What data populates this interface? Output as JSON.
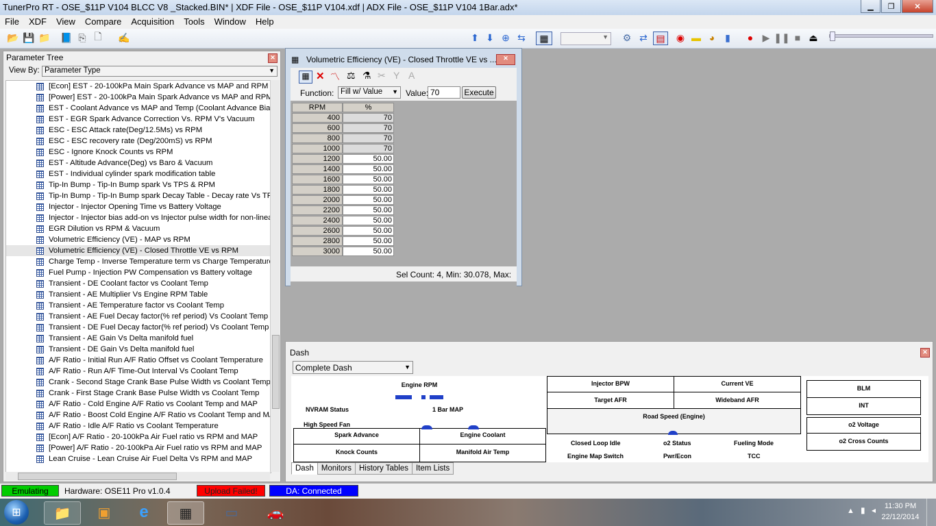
{
  "window": {
    "title": "TunerPro RT - OSE_$11P V104 BLCC V8 _Stacked.BIN* | XDF File - OSE_$11P V104.xdf | ADX File - OSE_$11P V104 1Bar.adx*"
  },
  "menu": [
    "File",
    "XDF",
    "View",
    "Compare",
    "Acquisition",
    "Tools",
    "Window",
    "Help"
  ],
  "param_tree": {
    "title": "Parameter Tree",
    "view_by_label": "View By:",
    "view_by_value": "Parameter Type",
    "items": [
      "[Econ] EST - 20-100kPa Main Spark Advance vs MAP and RPM",
      "[Power] EST - 20-100kPa Main Spark Advance vs MAP and RPM",
      "EST - Coolant Advance vs MAP and Temp (Coolant Advance Bias Te",
      "EST - EGR Spark Advance Correction Vs. RPM V's Vacuum",
      "ESC - ESC Attack rate(Deg/12.5Ms) vs RPM",
      "ESC - ESC recovery rate (Deg/200mS) vs RPM",
      "ESC - Ignore Knock Counts vs RPM",
      "EST - Altitude Advance(Deg) vs Baro & Vacuum",
      "EST - Individual cylinder spark modification table",
      "Tip-In Bump - Tip-In Bump spark Vs TPS & RPM",
      "Tip-In Bump - Tip-In Bump spark Decay Table - Decay rate Vs TPS",
      "Injector - Injector Opening Time vs Battery Voltage",
      "Injector - Injector bias add-on vs Injector pulse width for non-linea",
      "EGR Dilution vs RPM & Vacuum",
      "Volumetric Efficiency (VE) - MAP vs RPM",
      "Volumetric Efficiency (VE) - Closed Throttle VE vs RPM",
      "Charge Temp - Inverse Temperature term vs Charge Temperature",
      "Fuel Pump - Injection PW Compensation vs Battery voltage",
      "Transient - DE Coolant factor vs Coolant Temp",
      "Transient - AE Multiplier Vs Engine RPM Table",
      "Transient - AE Temperature factor vs Coolant Temp",
      "Transient - AE Fuel Decay factor(% ref period)  Vs Coolant Temp",
      "Transient - DE Fuel Decay factor(% ref period)  Vs Coolant Temp",
      "Transient - AE Gain Vs Delta manifold fuel",
      "Transient - DE Gain Vs Delta manifold fuel",
      "A/F Ratio - Initial Run A/F Ratio Offset vs Coolant Temperature",
      "A/F Ratio - Run A/F Time-Out Interval Vs Coolant Temp",
      "Crank - Second Stage Crank Base Pulse Width vs Coolant Temp",
      "Crank - First Stage Crank Base Pulse Width vs Coolant Temp",
      "A/F Ratio - Cold Engine A/F Ratio vs Coolant Temp and MAP",
      "A/F Ratio - Boost Cold Engine A/F Ratio vs Coolant Temp and MAP",
      "A/F Ratio - Idle A/F Ratio vs Coolant Temperature",
      "[Econ] A/F Ratio - 20-100kPa Air Fuel ratio vs RPM and MAP",
      "[Power] A/F Ratio - 20-100kPa Air Fuel ratio vs RPM and MAP",
      "Lean Cruise - Lean Cruise Air Fuel Delta Vs RPM and MAP"
    ]
  },
  "ve_window": {
    "title": "Volumetric Efficiency (VE) - Closed Throttle VE vs ...",
    "function_label": "Function:",
    "function_value": "Fill w/ Value",
    "value_label": "Value:",
    "value_input": "70",
    "execute_label": "Execute",
    "col_rpm": "RPM",
    "col_pct": "%",
    "rows": [
      {
        "rpm": "400",
        "val": "70",
        "hl": true
      },
      {
        "rpm": "600",
        "val": "70",
        "hl": true
      },
      {
        "rpm": "800",
        "val": "70",
        "hl": true
      },
      {
        "rpm": "1000",
        "val": "70",
        "hl": true
      },
      {
        "rpm": "1200",
        "val": "50.00",
        "hl": false
      },
      {
        "rpm": "1400",
        "val": "50.00",
        "hl": false
      },
      {
        "rpm": "1600",
        "val": "50.00",
        "hl": false
      },
      {
        "rpm": "1800",
        "val": "50.00",
        "hl": false
      },
      {
        "rpm": "2000",
        "val": "50.00",
        "hl": false
      },
      {
        "rpm": "2200",
        "val": "50.00",
        "hl": false
      },
      {
        "rpm": "2400",
        "val": "50.00",
        "hl": false
      },
      {
        "rpm": "2600",
        "val": "50.00",
        "hl": false
      },
      {
        "rpm": "2800",
        "val": "50.00",
        "hl": false
      },
      {
        "rpm": "3000",
        "val": "50.00",
        "hl": false
      }
    ],
    "status": "Sel Count: 4, Min: 30.078, Max:"
  },
  "dash": {
    "title": "Dash",
    "select_value": "Complete Dash",
    "engine_rpm": "Engine RPM",
    "nvram": "NVRAM Status",
    "one_bar_map": "1 Bar MAP",
    "high_speed_fan": "High Speed Fan",
    "spark_advance": "Spark Advance",
    "engine_coolant": "Engine Coolant",
    "knock_counts": "Knock Counts",
    "manifold_air_temp": "Manifold Air Temp",
    "injector_bpw": "Injector BPW",
    "current_ve": "Current VE",
    "target_afr": "Target AFR",
    "wideband_afr": "Wideband AFR",
    "road_speed": "Road Speed (Engine)",
    "closed_loop_idle": "Closed Loop Idle",
    "o2_status": "o2 Status",
    "fueling_mode": "Fueling Mode",
    "engine_map_switch": "Engine Map Switch",
    "pwr_econ": "Pwr/Econ",
    "tcc": "TCC",
    "blm": "BLM",
    "int": "INT",
    "o2_voltage": "o2 Voltage",
    "o2_cross_counts": "o2 Cross Counts",
    "tabs": [
      "Dash",
      "Monitors",
      "History Tables",
      "Item Lists"
    ]
  },
  "status": {
    "emulating": "Emulating",
    "hardware": "Hardware: OSE11 Pro v1.0.4",
    "upload": "Upload Failed!",
    "da": "DA: Connected"
  },
  "clock": {
    "time": "11:30 PM",
    "date": "22/12/2014"
  },
  "colors": {
    "emulating": "#00cc00",
    "upload": "#ff0000",
    "da": "#0000ff",
    "title": "#c3d5ec"
  }
}
